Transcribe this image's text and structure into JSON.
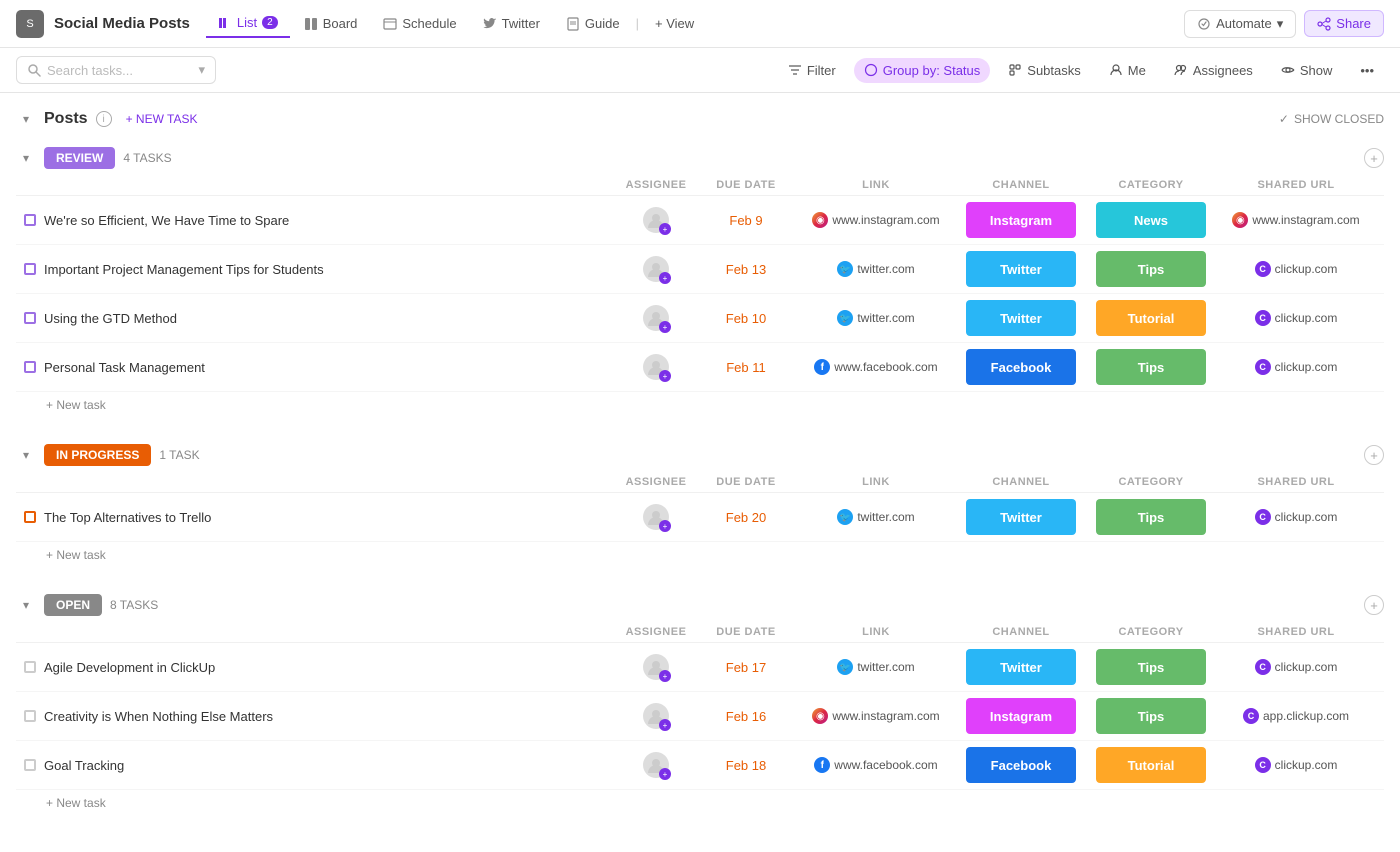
{
  "app": {
    "icon": "S",
    "title": "Social Media Posts"
  },
  "nav": {
    "tabs": [
      {
        "id": "list",
        "label": "List",
        "badge": "2",
        "active": true
      },
      {
        "id": "board",
        "label": "Board",
        "badge": null,
        "active": false
      },
      {
        "id": "schedule",
        "label": "Schedule",
        "badge": null,
        "active": false
      },
      {
        "id": "twitter",
        "label": "Twitter",
        "badge": null,
        "active": false
      },
      {
        "id": "guide",
        "label": "Guide",
        "badge": null,
        "active": false
      }
    ],
    "view_btn": "+ View",
    "automate_btn": "Automate",
    "share_btn": "Share"
  },
  "toolbar": {
    "search_placeholder": "Search tasks...",
    "filter_label": "Filter",
    "group_by_label": "Group by: Status",
    "subtasks_label": "Subtasks",
    "me_label": "Me",
    "assignees_label": "Assignees",
    "show_label": "Show"
  },
  "posts_section": {
    "title": "Posts",
    "new_task_label": "+ NEW TASK",
    "show_closed_label": "SHOW CLOSED"
  },
  "groups": [
    {
      "id": "review",
      "badge_label": "REVIEW",
      "badge_class": "review",
      "task_count": "4 TASKS",
      "col_headers": [
        "ASSIGNEE",
        "DUE DATE",
        "LINK",
        "CHANNEL",
        "CATEGORY",
        "SHARED URL"
      ],
      "tasks": [
        {
          "name": "We're so Efficient, We Have Time to Spare",
          "due": "Feb 9",
          "link_icon": "instagram",
          "link_url": "www.instagram.com",
          "channel": "Instagram",
          "channel_class": "instagram",
          "category": "News",
          "category_class": "news",
          "shared_icon": "instagram",
          "shared_url": "www.instagram.com"
        },
        {
          "name": "Important Project Management Tips for Students",
          "due": "Feb 13",
          "link_icon": "twitter",
          "link_url": "twitter.com",
          "channel": "Twitter",
          "channel_class": "twitter",
          "category": "Tips",
          "category_class": "tips",
          "shared_icon": "clickup",
          "shared_url": "clickup.com"
        },
        {
          "name": "Using the GTD Method",
          "due": "Feb 10",
          "link_icon": "twitter",
          "link_url": "twitter.com",
          "channel": "Twitter",
          "channel_class": "twitter",
          "category": "Tutorial",
          "category_class": "tutorial",
          "shared_icon": "clickup",
          "shared_url": "clickup.com"
        },
        {
          "name": "Personal Task Management",
          "due": "Feb 11",
          "link_icon": "facebook",
          "link_url": "www.facebook.com",
          "channel": "Facebook",
          "channel_class": "facebook",
          "category": "Tips",
          "category_class": "tips",
          "shared_icon": "clickup",
          "shared_url": "clickup.com"
        }
      ],
      "new_task_label": "+ New task"
    },
    {
      "id": "inprogress",
      "badge_label": "IN PROGRESS",
      "badge_class": "inprogress",
      "task_count": "1 TASK",
      "col_headers": [
        "ASSIGNEE",
        "DUE DATE",
        "LINK",
        "CHANNEL",
        "CATEGORY",
        "SHARED URL"
      ],
      "tasks": [
        {
          "name": "The Top Alternatives to Trello",
          "due": "Feb 20",
          "link_icon": "twitter",
          "link_url": "twitter.com",
          "channel": "Twitter",
          "channel_class": "twitter",
          "category": "Tips",
          "category_class": "tips",
          "shared_icon": "clickup",
          "shared_url": "clickup.com"
        }
      ],
      "new_task_label": "+ New task"
    },
    {
      "id": "open",
      "badge_label": "OPEN",
      "badge_class": "open",
      "task_count": "8 TASKS",
      "col_headers": [
        "ASSIGNEE",
        "DUE DATE",
        "LINK",
        "CHANNEL",
        "CATEGORY",
        "SHARED URL"
      ],
      "tasks": [
        {
          "name": "Agile Development in ClickUp",
          "due": "Feb 17",
          "link_icon": "twitter",
          "link_url": "twitter.com",
          "channel": "Twitter",
          "channel_class": "twitter",
          "category": "Tips",
          "category_class": "tips",
          "shared_icon": "clickup",
          "shared_url": "clickup.com"
        },
        {
          "name": "Creativity is When Nothing Else Matters",
          "due": "Feb 16",
          "link_icon": "instagram",
          "link_url": "www.instagram.com",
          "channel": "Instagram",
          "channel_class": "instagram",
          "category": "Tips",
          "category_class": "tips",
          "shared_icon": "clickup",
          "shared_url": "app.clickup.com"
        },
        {
          "name": "Goal Tracking",
          "due": "Feb 18",
          "link_icon": "facebook",
          "link_url": "www.facebook.com",
          "channel": "Facebook",
          "channel_class": "facebook",
          "category": "Tutorial",
          "category_class": "tutorial",
          "shared_icon": "clickup",
          "shared_url": "clickup.com"
        }
      ],
      "new_task_label": "+ New task"
    }
  ],
  "icons": {
    "instagram": "📷",
    "twitter": "🐦",
    "facebook": "f",
    "clickup": "C",
    "search": "🔍",
    "filter": "⚡",
    "chevron_down": "▾",
    "check": "✓",
    "plus": "+",
    "info": "i",
    "collapse": "▾",
    "more": "•••"
  }
}
